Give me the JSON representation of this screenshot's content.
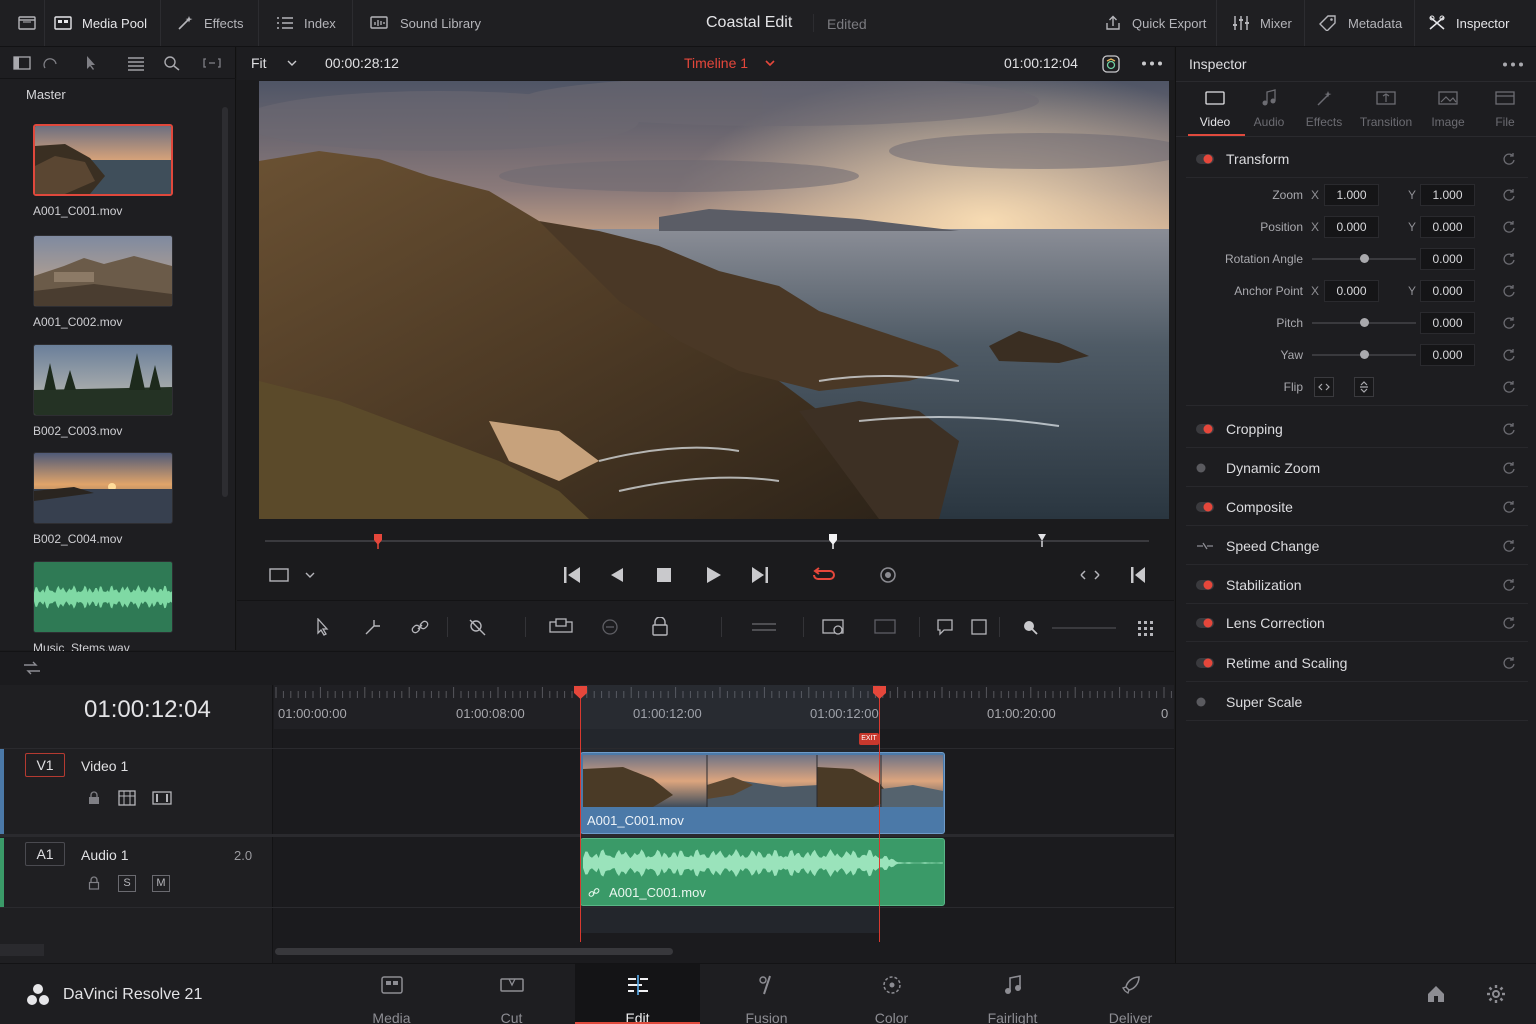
{
  "topbar": {
    "buttons": [
      {
        "label": "Media Pool",
        "icon": "media-pool-icon"
      },
      {
        "label": "Effects",
        "icon": "effects-icon"
      },
      {
        "label": "Index",
        "icon": "index-icon"
      },
      {
        "label": "Sound Library",
        "icon": "sound-library-icon"
      }
    ],
    "project_title": "Coastal Edit",
    "project_state": "Edited",
    "right_buttons": [
      {
        "label": "Quick Export",
        "icon": "export-icon"
      },
      {
        "label": "Mixer",
        "icon": "mixer-icon"
      },
      {
        "label": "Metadata",
        "icon": "metadata-icon"
      },
      {
        "label": "Inspector",
        "icon": "inspector-icon"
      }
    ]
  },
  "media_pool": {
    "bin": "Master",
    "clips": [
      {
        "name": "A001_C001.mov",
        "selected": true
      },
      {
        "name": "A001_C002.mov"
      },
      {
        "name": "B002_C003.mov"
      },
      {
        "name": "B002_C004.mov"
      },
      {
        "name": "Music_Stems.wav"
      }
    ]
  },
  "viewer": {
    "zoom": "Fit",
    "source_timecode": "00:00:28:12",
    "timeline_name": "Timeline 1",
    "record_timecode": "01:00:12:04"
  },
  "inspector": {
    "title": "Inspector",
    "tabs": [
      "Video",
      "Audio",
      "Effects",
      "Transition",
      "Image",
      "File"
    ],
    "active_tab": "Video",
    "transform": {
      "label": "Transform",
      "zoom": {
        "label": "Zoom",
        "x": "1.000",
        "y": "1.000"
      },
      "position": {
        "label": "Position",
        "x": "0.000",
        "y": "0.000"
      },
      "rotation": {
        "label": "Rotation Angle",
        "value": "0.000"
      },
      "anchor": {
        "label": "Anchor Point",
        "x": "0.000",
        "y": "0.000"
      },
      "pitch": {
        "label": "Pitch",
        "value": "0.000"
      },
      "yaw": {
        "label": "Yaw",
        "value": "0.000"
      },
      "flip": {
        "label": "Flip"
      },
      "axis_x": "X",
      "axis_y": "Y"
    },
    "sections": [
      {
        "label": "Cropping",
        "on": true
      },
      {
        "label": "Dynamic Zoom",
        "on": false
      },
      {
        "label": "Composite",
        "on": true
      },
      {
        "label": "Speed Change",
        "on": false
      },
      {
        "label": "Stabilization",
        "on": true
      },
      {
        "label": "Lens Correction",
        "on": true
      },
      {
        "label": "Retime and Scaling",
        "on": true
      },
      {
        "label": "Super Scale",
        "on": false
      }
    ]
  },
  "timeline": {
    "current_timecode": "01:00:12:04",
    "ruler_labels": [
      "01:00:00:00",
      "01:00:08:00",
      "01:00:12:00",
      "01:00:12:00",
      "01:00:20:00",
      "0"
    ],
    "exit_marker": "EXIT",
    "tracks": {
      "video": {
        "id": "V1",
        "name": "Video 1",
        "clip": "A001_C001.mov"
      },
      "audio": {
        "id": "A1",
        "name": "Audio 1",
        "channels": "2.0",
        "clip": "A001_C001.mov",
        "solo": "S",
        "mute": "M"
      }
    }
  },
  "bottombar": {
    "app_name": "DaVinci Resolve 21",
    "pages": [
      "Media",
      "Cut",
      "Edit",
      "Fusion",
      "Color",
      "Fairlight",
      "Deliver"
    ],
    "active_page": "Edit"
  },
  "colors": {
    "accent": "#e04a3d",
    "video_clip": "#4b79a8",
    "audio_clip": "#3a9a68"
  }
}
